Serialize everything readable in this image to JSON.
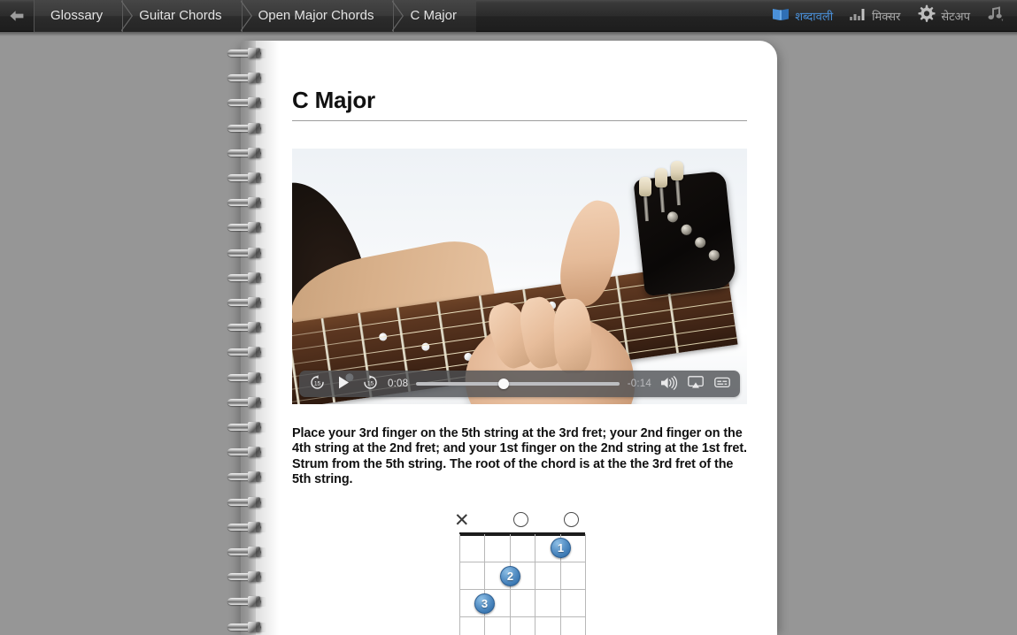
{
  "toolbar": {
    "back_icon": "back-arrow-icon",
    "breadcrumbs": [
      {
        "label": "Glossary"
      },
      {
        "label": "Guitar Chords"
      },
      {
        "label": "Open Major Chords"
      },
      {
        "label": "C Major"
      }
    ],
    "right_items": [
      {
        "icon": "book-icon",
        "label": "शब्दावली",
        "active": true
      },
      {
        "icon": "mixer-icon",
        "label": "मिक्सर",
        "active": false
      },
      {
        "icon": "gear-icon",
        "label": "सेटअप",
        "active": false
      },
      {
        "icon": "music-note-icon",
        "label": "",
        "active": false
      }
    ],
    "accent_color": "#4a90d9",
    "background_color": "#2b2b2b"
  },
  "page": {
    "title": "C Major",
    "body_text": "Place your 3rd finger on the 5th string at the 3rd fret; your 2nd finger on the 4th string at the 2nd fret; and your 1st finger on the 2nd string at the 1st fret. Strum from the 5th string. The root of the chord is at the the 3rd fret of the 5th string."
  },
  "video": {
    "elapsed_time": "0:08",
    "remaining_time": "-0:14",
    "progress_percent": 43,
    "skip_back_label": "15",
    "skip_forward_label": "15",
    "controls": [
      "skip-back-15-icon",
      "play-icon",
      "skip-forward-15-icon",
      "volume-icon",
      "airplay-icon",
      "subtitles-icon"
    ]
  },
  "chord_diagram": {
    "name": "C Major",
    "strings": 6,
    "frets": 4,
    "string_markers": [
      "x",
      "",
      "",
      "",
      "o",
      "o"
    ],
    "fingers": [
      {
        "label": "1",
        "string": 2,
        "fret": 1
      },
      {
        "label": "2",
        "string": 4,
        "fret": 2
      },
      {
        "label": "3",
        "string": 5,
        "fret": 3
      }
    ],
    "finger_color": "#4180b8"
  }
}
